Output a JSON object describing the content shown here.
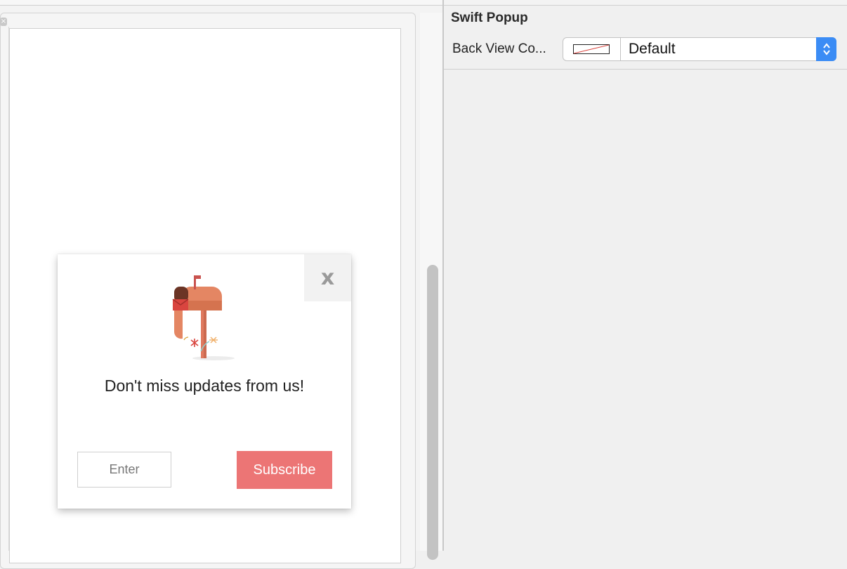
{
  "popup": {
    "close_glyph": "x",
    "message": "Don't miss updates from us!",
    "input_placeholder": "Enter",
    "subscribe_label": "Subscribe",
    "subscribe_color": "#ec7575",
    "illustration": "mailbox-icon"
  },
  "inspector": {
    "section_title": "Swift Popup",
    "property_label": "Back View Co...",
    "property_value": "Default",
    "accent_color": "#3b8cf5"
  },
  "canvas": {
    "scene_close_glyph": "×"
  }
}
